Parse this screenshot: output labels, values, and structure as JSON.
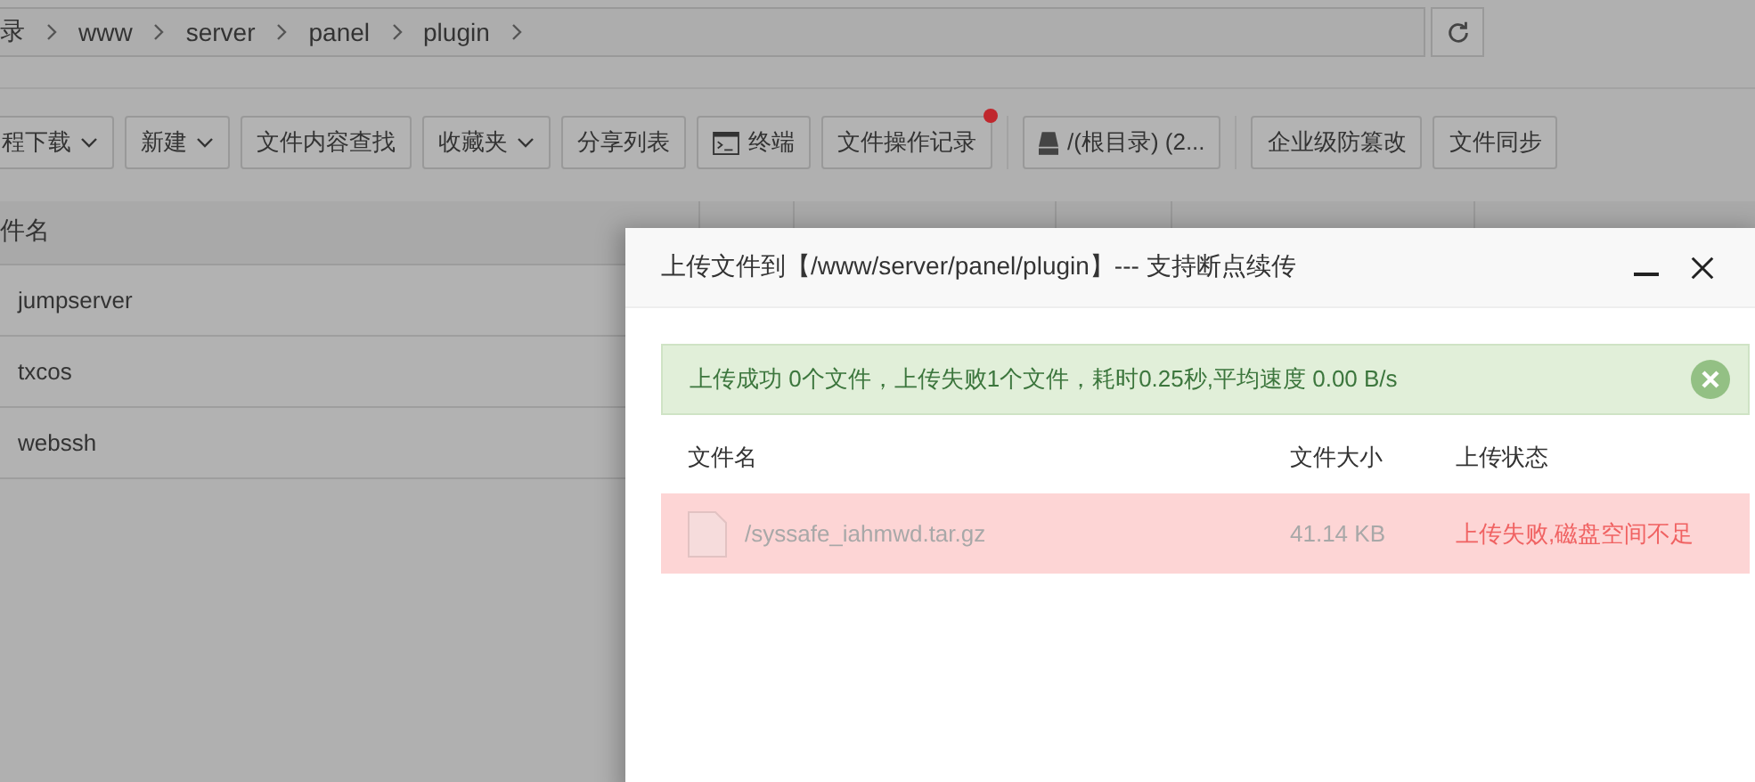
{
  "breadcrumb": {
    "items": [
      "录",
      "www",
      "server",
      "panel",
      "plugin"
    ]
  },
  "toolbar": {
    "groups": [
      [
        {
          "label": "程下载",
          "kind": "dropdown",
          "notification": false
        },
        {
          "label": "新建",
          "kind": "dropdown",
          "notification": false
        },
        {
          "label": "文件内容查找",
          "kind": "plain",
          "notification": false
        },
        {
          "label": "收藏夹",
          "kind": "dropdown",
          "notification": false
        },
        {
          "label": "分享列表",
          "kind": "plain",
          "notification": false
        },
        {
          "label": "终端",
          "kind": "terminal",
          "notification": false
        },
        {
          "label": "文件操作记录",
          "kind": "plain",
          "notification": true
        }
      ],
      [
        {
          "label": "/(根目录) (2...",
          "kind": "disk",
          "notification": false
        }
      ],
      [
        {
          "label": "企业级防篡改",
          "kind": "plain",
          "notification": false
        },
        {
          "label": "文件同步",
          "kind": "plain",
          "notification": false
        }
      ]
    ]
  },
  "table": {
    "columns": [
      "件名"
    ],
    "rows": [
      {
        "name": "jumpserver"
      },
      {
        "name": "txcos"
      },
      {
        "name": "webssh"
      }
    ]
  },
  "dialog": {
    "title": "上传文件到【/www/server/panel/plugin】--- 支持断点续传",
    "alert": "上传成功 0个文件，上传失败1个文件，耗时0.25秒,平均速度 0.00 B/s",
    "columns": [
      "文件名",
      "文件大小",
      "上传状态"
    ],
    "files": [
      {
        "name": "/syssafe_iahmwd.tar.gz",
        "size": "41.14 KB",
        "status": "上传失败,磁盘空间不足",
        "failed": true
      }
    ]
  }
}
